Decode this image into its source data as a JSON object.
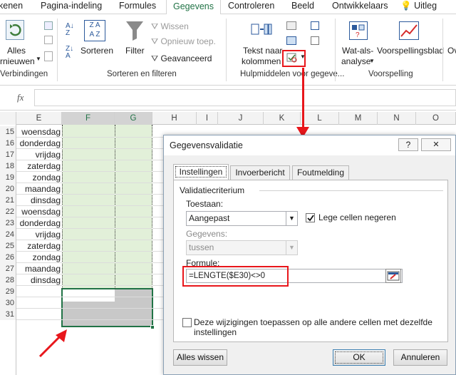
{
  "ribbon_tabs": [
    "Gegevens",
    "Pagina-indeling",
    "Formules",
    "Gegevens",
    "Controleren",
    "Beeld",
    "Ontwikkelaars",
    "Uitleg"
  ],
  "tabs": {
    "t0": "Gegevens",
    "t1": "Pagina-indeling",
    "t2": "Formules",
    "t3": "Gegevens",
    "t4": "Controleren",
    "t5": "Beeld",
    "t6": "Ontwikkelaars",
    "t7": "Uitleg"
  },
  "ribbon": {
    "alles_1": "Alles",
    "alles_2": "rnieuwen",
    "verbindingen": "Verbindingen",
    "sorteren": "Sorteren",
    "filter": "Filter",
    "wissen": "Wissen",
    "opnieuw": "Opnieuw toep.",
    "geavanceerd": "Geavanceerd",
    "sorteren_filteren": "Sorteren en filteren",
    "tekst_1": "Tekst naar",
    "tekst_2": "kolommen",
    "hulpmiddelen": "Hulpmiddelen voor gegeve...",
    "watals_1": "Wat-als-",
    "watals_2": "analyse",
    "voorspellingsblad": "Voorspellingsblad",
    "voorspelling": "Voorspelling",
    "ov": "Ov"
  },
  "formula_bar": {
    "fx": "fx",
    "value": ""
  },
  "columns": [
    "E",
    "F",
    "G",
    "H",
    "I",
    "J",
    "K",
    "L",
    "M",
    "N",
    "O"
  ],
  "rows": [
    {
      "num": "15",
      "day": "woensdag"
    },
    {
      "num": "16",
      "day": "donderdag"
    },
    {
      "num": "17",
      "day": "vrijdag"
    },
    {
      "num": "18",
      "day": "zaterdag"
    },
    {
      "num": "19",
      "day": "zondag"
    },
    {
      "num": "20",
      "day": "maandag"
    },
    {
      "num": "21",
      "day": "dinsdag"
    },
    {
      "num": "22",
      "day": "woensdag"
    },
    {
      "num": "23",
      "day": "donderdag"
    },
    {
      "num": "24",
      "day": "vrijdag"
    },
    {
      "num": "25",
      "day": "zaterdag"
    },
    {
      "num": "26",
      "day": "zondag"
    },
    {
      "num": "27",
      "day": "maandag"
    },
    {
      "num": "28",
      "day": "dinsdag"
    },
    {
      "num": "29",
      "day": ""
    },
    {
      "num": "30",
      "day": ""
    },
    {
      "num": "31",
      "day": ""
    }
  ],
  "dialog": {
    "title": "Gegevensvalidatie",
    "help": "?",
    "close": "✕",
    "tab_instellingen": "Instellingen",
    "tab_invoerbericht": "Invoerbericht",
    "tab_foutmelding": "Foutmelding",
    "group_label": "Validatiecriterium",
    "toestaan_label": "Toestaan:",
    "toestaan_value": "Aangepast",
    "lege_cellen": "Lege cellen negeren",
    "gegevens_label": "Gegevens:",
    "gegevens_value": "tussen",
    "formule_label": "Formule:",
    "formule_value": "=LENGTE($E30)<>0",
    "apply_1": "Deze wijzigingen toepassen op alle andere cellen met dezelfde",
    "apply_2": "instellingen",
    "btn_clear": "Alles wissen",
    "btn_ok": "OK",
    "btn_cancel": "Annuleren"
  },
  "colors": {
    "accent": "#217346",
    "highlight": "#e8161b",
    "sel_fill": "#e2f0d9",
    "gray_fill": "#c8c8c8"
  }
}
